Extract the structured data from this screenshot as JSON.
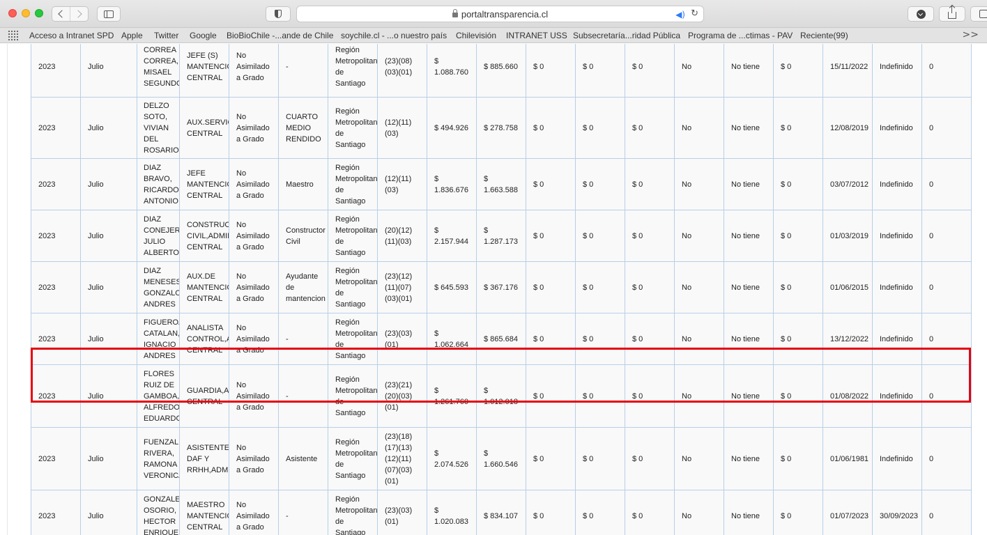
{
  "browser": {
    "url": "portaltransparencia.cl",
    "bookmarks": [
      "Acceso a Intranet SPD",
      "Apple",
      "Twitter",
      "Google",
      "BioBioChile -...ande de Chile",
      "soychile.cl - ...o nuestro país",
      "Chilevisión",
      "INTRANET USS",
      "Subsecretaría...ridad Pública",
      "Programa de ...ctimas - PAV",
      "Reciente(99)"
    ],
    "more": ">>"
  },
  "table": {
    "rows": [
      {
        "year": "2023",
        "month": "Julio",
        "name": [
          "CORREA",
          "CORREA,",
          "MISAEL",
          "SEGUNDO"
        ],
        "cargo": [
          "JEFE (S)",
          "MANTENCION",
          "CENTRAL"
        ],
        "grado": [
          "No",
          "Asimilado",
          "a Grado"
        ],
        "funcion": [
          "-"
        ],
        "region": [
          "Región",
          "Metropolitana",
          "de",
          "Santiago"
        ],
        "asign": [
          "(23)(08)",
          "(03)(01)"
        ],
        "bruta": [
          "$",
          "1.088.760"
        ],
        "liquida": [
          "$ 885.660"
        ],
        "c1": "$ 0",
        "c2": "$ 0",
        "c3": "$ 0",
        "horas": "No",
        "viatico": "No tiene",
        "c4": "$ 0",
        "inicio": "15/11/2022",
        "termino": "Indefinido",
        "obs": "0"
      },
      {
        "year": "2023",
        "month": "Julio",
        "name": [
          "DELZO",
          "SOTO,",
          "VIVIAN",
          "DEL",
          "ROSARIO"
        ],
        "cargo": [
          "AUX.SERVICIOS",
          "CENTRAL"
        ],
        "grado": [
          "No",
          "Asimilado",
          "a Grado"
        ],
        "funcion": [
          "CUARTO",
          "MEDIO",
          "RENDIDO"
        ],
        "region": [
          "Región",
          "Metropolitana",
          "de",
          "Santiago"
        ],
        "asign": [
          "(12)(11)",
          "(03)"
        ],
        "bruta": [
          "$ 494.926"
        ],
        "liquida": [
          "$ 278.758"
        ],
        "c1": "$ 0",
        "c2": "$ 0",
        "c3": "$ 0",
        "horas": "No",
        "viatico": "No tiene",
        "c4": "$ 0",
        "inicio": "12/08/2019",
        "termino": "Indefinido",
        "obs": "0"
      },
      {
        "year": "2023",
        "month": "Julio",
        "name": [
          "DIAZ",
          "BRAVO,",
          "RICARDO",
          "ANTONIO"
        ],
        "cargo": [
          "JEFE",
          "MANTENCION",
          "CENTRAL"
        ],
        "grado": [
          "No",
          "Asimilado",
          "a Grado"
        ],
        "funcion": [
          "Maestro"
        ],
        "region": [
          "Región",
          "Metropolitana",
          "de",
          "Santiago"
        ],
        "asign": [
          "(12)(11)",
          "(03)"
        ],
        "bruta": [
          "$",
          "1.836.676"
        ],
        "liquida": [
          "$",
          "1.663.588"
        ],
        "c1": "$ 0",
        "c2": "$ 0",
        "c3": "$ 0",
        "horas": "No",
        "viatico": "No tiene",
        "c4": "$ 0",
        "inicio": "03/07/2012",
        "termino": "Indefinido",
        "obs": "0"
      },
      {
        "year": "2023",
        "month": "Julio",
        "name": [
          "DIAZ",
          "CONEJEROS,",
          "JULIO",
          "ALBERTO"
        ],
        "cargo": [
          "CONSTRUCTOR",
          "CIVIL,ADMIN",
          "CENTRAL"
        ],
        "grado": [
          "No",
          "Asimilado",
          "a Grado"
        ],
        "funcion": [
          "Constructor",
          "Civil"
        ],
        "region": [
          "Región",
          "Metropolitana",
          "de",
          "Santiago"
        ],
        "asign": [
          "(20)(12)",
          "(11)(03)"
        ],
        "bruta": [
          "$",
          "2.157.944"
        ],
        "liquida": [
          "$",
          "1.287.173"
        ],
        "c1": "$ 0",
        "c2": "$ 0",
        "c3": "$ 0",
        "horas": "No",
        "viatico": "No tiene",
        "c4": "$ 0",
        "inicio": "01/03/2019",
        "termino": "Indefinido",
        "obs": "0"
      },
      {
        "year": "2023",
        "month": "Julio",
        "name": [
          "DIAZ",
          "MENESES,",
          "GONZALO",
          "ANDRES"
        ],
        "cargo": [
          "AUX.DE",
          "MANTENCION",
          "CENTRAL"
        ],
        "grado": [
          "No",
          "Asimilado",
          "a Grado"
        ],
        "funcion": [
          "Ayudante",
          "de",
          "mantencion"
        ],
        "region": [
          "Región",
          "Metropolitana",
          "de",
          "Santiago"
        ],
        "asign": [
          "(23)(12)",
          "(11)(07)",
          "(03)(01)"
        ],
        "bruta": [
          "$ 645.593"
        ],
        "liquida": [
          "$ 367.176"
        ],
        "c1": "$ 0",
        "c2": "$ 0",
        "c3": "$ 0",
        "horas": "No",
        "viatico": "No tiene",
        "c4": "$ 0",
        "inicio": "01/06/2015",
        "termino": "Indefinido",
        "obs": "0"
      },
      {
        "year": "2023",
        "month": "Julio",
        "name": [
          "FIGUEROA",
          "CATALAN,",
          "IGNACIO",
          "ANDRES"
        ],
        "cargo": [
          "ANALISTA",
          "CONTROL,ADM",
          "CENTRAL"
        ],
        "grado": [
          "No",
          "Asimilado",
          "a Grado"
        ],
        "funcion": [
          "-"
        ],
        "region": [
          "Región",
          "Metropolitana",
          "de",
          "Santiago"
        ],
        "asign": [
          "(23)(03)",
          "(01)"
        ],
        "bruta": [
          "$",
          "1.062.664"
        ],
        "liquida": [
          "$ 865.684"
        ],
        "c1": "$ 0",
        "c2": "$ 0",
        "c3": "$ 0",
        "horas": "No",
        "viatico": "No tiene",
        "c4": "$ 0",
        "inicio": "13/12/2022",
        "termino": "Indefinido",
        "obs": "0"
      },
      {
        "year": "2023",
        "month": "Julio",
        "name": [
          "FLORES",
          "RUIZ DE",
          "GAMBOA,",
          "ALFREDO",
          "EDUARDO"
        ],
        "cargo": [
          "GUARDIA,ADM",
          "CENTRAL"
        ],
        "grado": [
          "No",
          "Asimilado",
          "a Grado"
        ],
        "funcion": [
          "-"
        ],
        "region": [
          "Región",
          "Metropolitana",
          "de",
          "Santiago"
        ],
        "asign": [
          "(23)(21)",
          "(20)(03)",
          "(01)"
        ],
        "bruta": [
          "$",
          "1.261.760"
        ],
        "liquida": [
          "$",
          "1.012.018"
        ],
        "c1": "$ 0",
        "c2": "$ 0",
        "c3": "$ 0",
        "horas": "No",
        "viatico": "No tiene",
        "c4": "$ 0",
        "inicio": "01/08/2022",
        "termino": "Indefinido",
        "obs": "0"
      },
      {
        "year": "2023",
        "month": "Julio",
        "name": [
          "FUENZALIDA",
          "RIVERA,",
          "RAMONA",
          "VERONICA"
        ],
        "cargo": [
          "ASISTENTE",
          "DAF Y",
          "RRHH,ADM"
        ],
        "grado": [
          "No",
          "Asimilado",
          "a Grado"
        ],
        "funcion": [
          "Asistente"
        ],
        "region": [
          "Región",
          "Metropolitana",
          "de",
          "Santiago"
        ],
        "asign": [
          "(23)(18)",
          "(17)(13)",
          "(12)(11)",
          "(07)(03)",
          "(01)"
        ],
        "bruta": [
          "$",
          "2.074.526"
        ],
        "liquida": [
          "$",
          "1.660.546"
        ],
        "c1": "$ 0",
        "c2": "$ 0",
        "c3": "$ 0",
        "horas": "No",
        "viatico": "No tiene",
        "c4": "$ 0",
        "inicio": "01/06/1981",
        "termino": "Indefinido",
        "obs": "0"
      },
      {
        "year": "2023",
        "month": "Julio",
        "name": [
          "GONZALEZ",
          "OSORIO,",
          "HECTOR",
          "ENRIQUE"
        ],
        "cargo": [
          "MAESTRO",
          "MANTENCION",
          "CENTRAL"
        ],
        "grado": [
          "No",
          "Asimilado",
          "a Grado"
        ],
        "funcion": [
          "-"
        ],
        "region": [
          "Región",
          "Metropolitana",
          "de",
          "Santiago"
        ],
        "asign": [
          "(23)(03)",
          "(01)"
        ],
        "bruta": [
          "$",
          "1.020.083"
        ],
        "liquida": [
          "$ 834.107"
        ],
        "c1": "$ 0",
        "c2": "$ 0",
        "c3": "$ 0",
        "horas": "No",
        "viatico": "No tiene",
        "c4": "$ 0",
        "inicio": "01/07/2023",
        "termino": "30/09/2023",
        "obs": "0"
      }
    ]
  },
  "colors": {
    "highlight": "#e4000f",
    "grid": "#b8cfe4",
    "audio": "#2e7bf6"
  }
}
